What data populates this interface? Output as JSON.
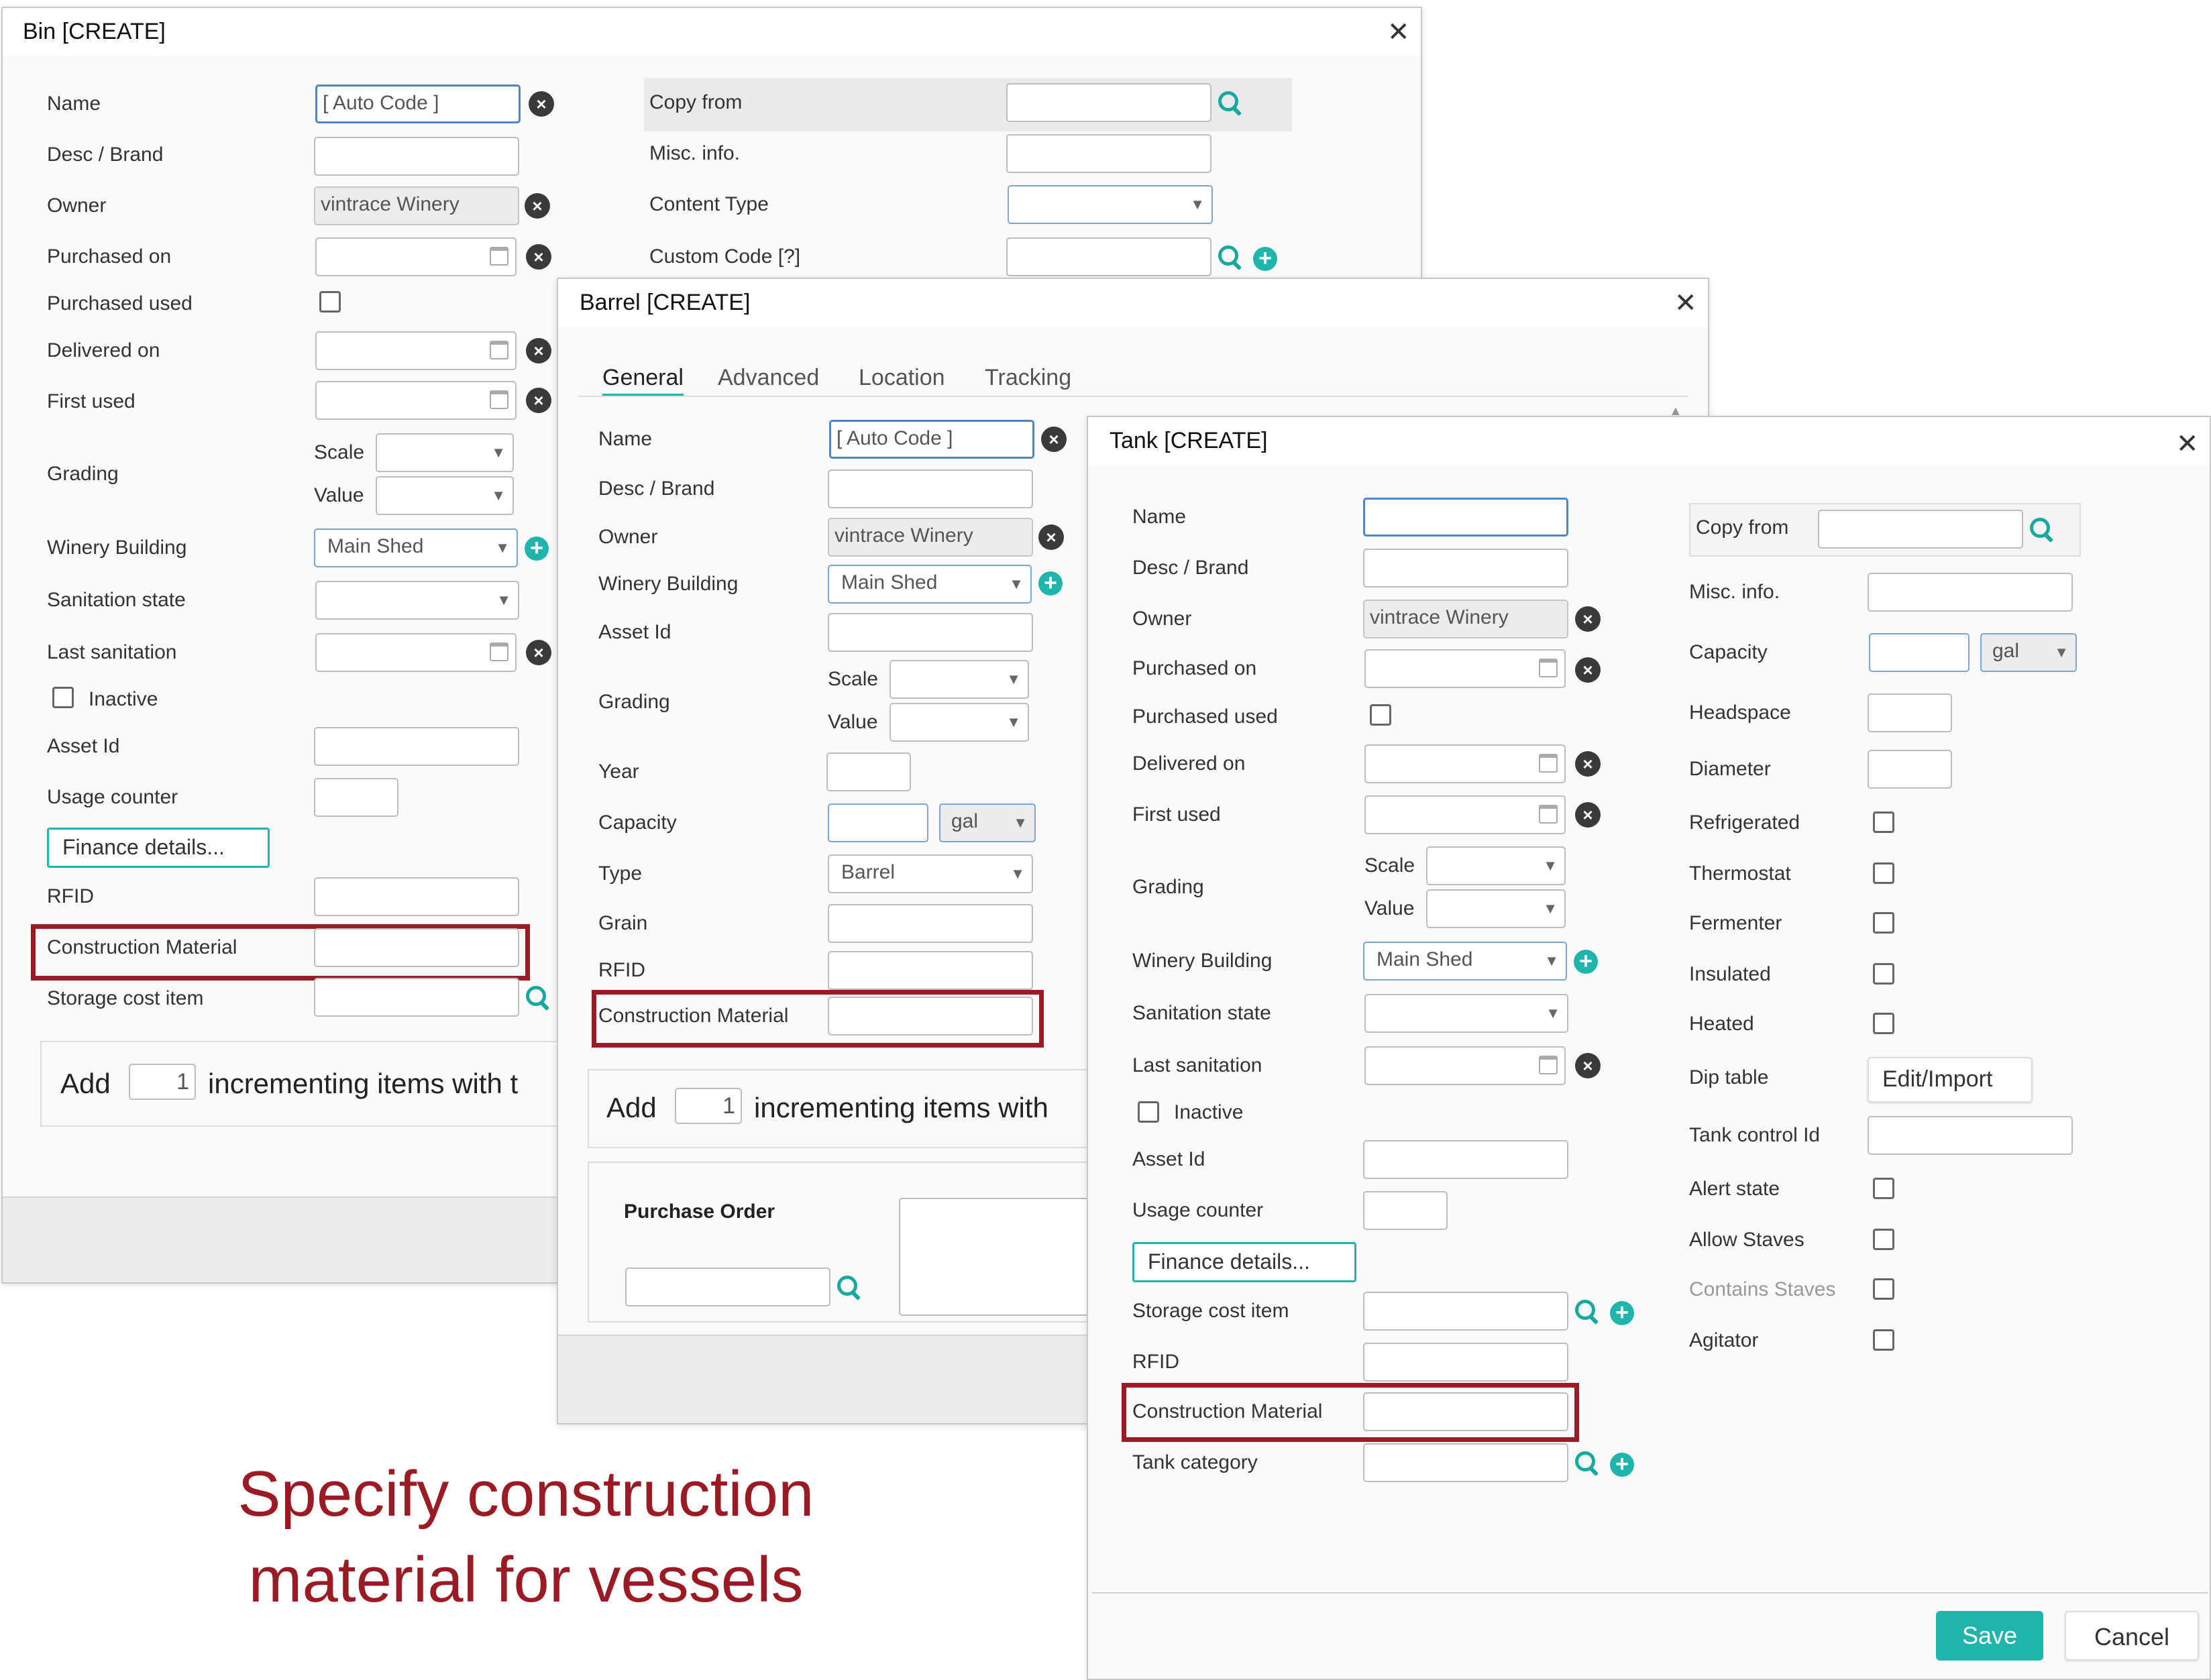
{
  "bin": {
    "title": "Bin [CREATE]",
    "close": "✕",
    "name_label": "Name",
    "name_value": "[ Auto Code ]",
    "desc_label": "Desc / Brand",
    "owner_label": "Owner",
    "owner_value": "vintrace Winery",
    "purchased_on_label": "Purchased on",
    "purchased_used_label": "Purchased used",
    "delivered_on_label": "Delivered on",
    "first_used_label": "First used",
    "grading_label": "Grading",
    "scale_label": "Scale",
    "value_label": "Value",
    "winery_building_label": "Winery Building",
    "winery_building_value": "Main Shed",
    "sanitation_state_label": "Sanitation state",
    "last_sanitation_label": "Last sanitation",
    "inactive_label": "Inactive",
    "asset_id_label": "Asset Id",
    "usage_counter_label": "Usage counter",
    "finance_button": "Finance details...",
    "rfid_label": "RFID",
    "construction_material_label": "Construction Material",
    "storage_cost_label": "Storage cost item",
    "copy_from_label": "Copy from",
    "misc_info_label": "Misc. info.",
    "content_type_label": "Content Type",
    "custom_code_label": "Custom Code [?]",
    "add_label": "Add",
    "add_count": "1",
    "add_suffix": "incrementing items with t"
  },
  "barrel": {
    "title": "Barrel [CREATE]",
    "close": "✕",
    "tabs": [
      "General",
      "Advanced",
      "Location",
      "Tracking"
    ],
    "name_label": "Name",
    "name_value": "[ Auto Code ]",
    "desc_label": "Desc / Brand",
    "owner_label": "Owner",
    "owner_value": "vintrace Winery",
    "winery_building_label": "Winery Building",
    "winery_building_value": "Main Shed",
    "asset_id_label": "Asset Id",
    "grading_label": "Grading",
    "scale_label": "Scale",
    "value_label": "Value",
    "year_label": "Year",
    "capacity_label": "Capacity",
    "capacity_unit": "gal",
    "type_label": "Type",
    "type_value": "Barrel",
    "grain_label": "Grain",
    "rfid_label": "RFID",
    "construction_material_label": "Construction Material",
    "add_label": "Add",
    "add_count": "1",
    "add_suffix": "incrementing items with",
    "purchase_order_label": "Purchase Order"
  },
  "tank": {
    "title": "Tank [CREATE]",
    "close": "✕",
    "name_label": "Name",
    "desc_label": "Desc / Brand",
    "owner_label": "Owner",
    "owner_value": "vintrace Winery",
    "purchased_on_label": "Purchased on",
    "purchased_used_label": "Purchased used",
    "delivered_on_label": "Delivered on",
    "first_used_label": "First used",
    "grading_label": "Grading",
    "scale_label": "Scale",
    "value_label": "Value",
    "winery_building_label": "Winery Building",
    "winery_building_value": "Main Shed",
    "sanitation_state_label": "Sanitation state",
    "last_sanitation_label": "Last sanitation",
    "inactive_label": "Inactive",
    "asset_id_label": "Asset Id",
    "usage_counter_label": "Usage counter",
    "finance_button": "Finance details...",
    "storage_cost_label": "Storage cost item",
    "rfid_label": "RFID",
    "construction_material_label": "Construction Material",
    "tank_category_label": "Tank category",
    "copy_from_label": "Copy from",
    "misc_info_label": "Misc. info.",
    "capacity_label": "Capacity",
    "capacity_unit": "gal",
    "headspace_label": "Headspace",
    "diameter_label": "Diameter",
    "refrigerated_label": "Refrigerated",
    "thermostat_label": "Thermostat",
    "fermenter_label": "Fermenter",
    "insulated_label": "Insulated",
    "heated_label": "Heated",
    "dip_table_label": "Dip table",
    "dip_table_button": "Edit/Import",
    "tank_control_label": "Tank control Id",
    "alert_state_label": "Alert state",
    "allow_staves_label": "Allow Staves",
    "contains_staves_label": "Contains Staves",
    "agitator_label": "Agitator",
    "save_button": "Save",
    "cancel_button": "Cancel"
  },
  "caption": {
    "line1": "Specify construction",
    "line2": "material for vessels"
  },
  "colors": {
    "accent": "#1fb5ad",
    "highlight": "#9b1b24",
    "focus_border": "#4d86c8"
  }
}
